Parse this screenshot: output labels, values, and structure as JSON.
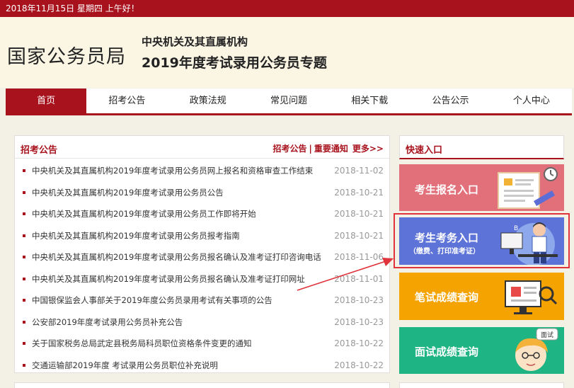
{
  "topbar": {
    "date": "2018年11月15日  星期四  上午好！"
  },
  "header": {
    "logo": "国家公务员局",
    "sub1": "中央机关及其直属机构",
    "sub2": "2019年度考试录用公务员专题"
  },
  "nav": [
    "首页",
    "招考公告",
    "政策法规",
    "常见问题",
    "相关下载",
    "公告公示",
    "个人中心"
  ],
  "main": {
    "title": "招考公告",
    "links": {
      "a": "招考公告",
      "b": "重要通知",
      "more": "更多>>"
    },
    "items": [
      {
        "title": "中央机关及其直属机构2019年度考试录用公务员网上报名和资格审查工作结束",
        "date": "2018-11-02"
      },
      {
        "title": "中央机关及其直属机构2019年度考试录用公务员公告",
        "date": "2018-10-21"
      },
      {
        "title": "中央机关及其直属机构2019年度考试录用公务员工作即将开始",
        "date": "2018-10-21"
      },
      {
        "title": "中央机关及其直属机构2019年度考试录用公务员报考指南",
        "date": "2018-10-21"
      },
      {
        "title": "中央机关及其直属机构2019年度考试录用公务员报名确认及准考证打印咨询电话",
        "date": "2018-11-06"
      },
      {
        "title": "中央机关及其直属机构2019年度考试录用公务员报名确认及准考证打印网址",
        "date": "2018-11-01"
      },
      {
        "title": "中国银保监会人事部关于2019年度公务员录用考试有关事项的公告",
        "date": "2018-10-23"
      },
      {
        "title": "公安部2019年度考试录用公务员补充公告",
        "date": "2018-10-23"
      },
      {
        "title": "关于国家税务总局武定县税务局科员职位资格条件变更的通知",
        "date": "2018-10-22"
      },
      {
        "title": "交通运输部2019年度 考试录用公务员职位补充说明",
        "date": "2018-10-22"
      }
    ]
  },
  "side": {
    "title": "快速入口",
    "btn1": "考生报名入口",
    "btn2": "考生考务入口",
    "btn2_sub": "（缴费、打印准考证）",
    "btn3": "笔试成绩查询",
    "btn4": "面试成绩查询",
    "btn4_bubble": "面试"
  },
  "colors": {
    "brand": "#a8121d",
    "highlight": "#e0333b"
  }
}
